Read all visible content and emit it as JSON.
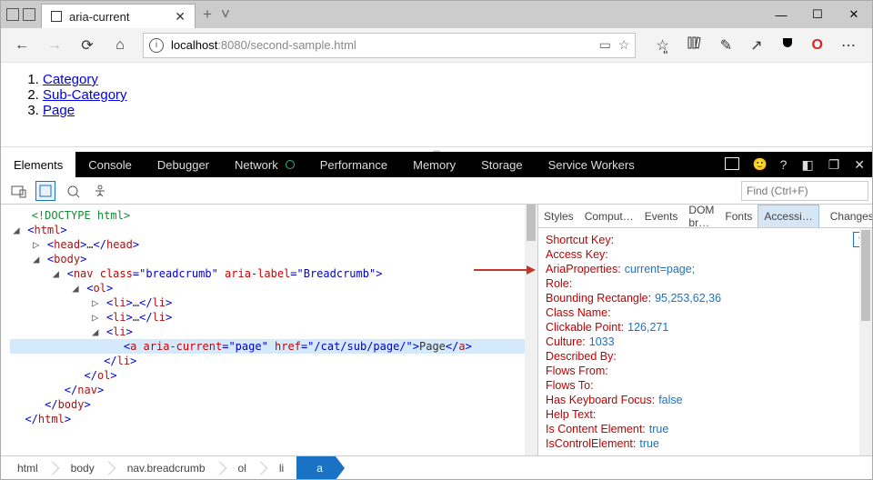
{
  "window": {
    "tab_title": "aria-current"
  },
  "url": {
    "prefix": "localhost",
    "port_path": ":8080/second-sample.html"
  },
  "page_links": {
    "l1": "Category",
    "l2": "Sub-Category",
    "l3": "Page"
  },
  "devtools": {
    "tabs": {
      "elements": "Elements",
      "console": "Console",
      "debugger": "Debugger",
      "network": "Network",
      "performance": "Performance",
      "memory": "Memory",
      "storage": "Storage",
      "service_workers": "Service Workers"
    },
    "find_placeholder": "Find (Ctrl+F)",
    "side_tabs": {
      "styles": "Styles",
      "computed": "Comput…",
      "events": "Events",
      "dom": "DOM br…",
      "fonts": "Fonts",
      "accessibility": "Accessi…",
      "changes": "Changes"
    }
  },
  "dom": {
    "doctype": "<!DOCTYPE html>",
    "nav_class": "breadcrumb",
    "nav_aria_label": "Breadcrumb",
    "a_aria_current": "page",
    "a_href": "/cat/sub/page/",
    "a_text": "Page"
  },
  "accessibility": {
    "shortcut_key": {
      "k": "Shortcut Key:",
      "v": ""
    },
    "access_key": {
      "k": "Access Key:",
      "v": ""
    },
    "aria_properties": {
      "k": "AriaProperties:",
      "v": "current=page;"
    },
    "role": {
      "k": "Role:",
      "v": ""
    },
    "bounding_rect": {
      "k": "Bounding Rectangle:",
      "v": "95,253,62,36"
    },
    "class_name": {
      "k": "Class Name:",
      "v": ""
    },
    "clickable_point": {
      "k": "Clickable Point:",
      "v": "126,271"
    },
    "culture": {
      "k": "Culture:",
      "v": "1033"
    },
    "described_by": {
      "k": "Described By:",
      "v": ""
    },
    "flows_from": {
      "k": "Flows From:",
      "v": ""
    },
    "flows_to": {
      "k": "Flows To:",
      "v": ""
    },
    "has_keyboard_focus": {
      "k": "Has Keyboard Focus:",
      "v": "false"
    },
    "help_text": {
      "k": "Help Text:",
      "v": ""
    },
    "is_content_element": {
      "k": "Is Content Element:",
      "v": "true"
    },
    "is_control_element": {
      "k": "IsControlElement:",
      "v": "true"
    }
  },
  "breadcrumbs": {
    "b1": "html",
    "b2": "body",
    "b3": "nav.breadcrumb",
    "b4": "ol",
    "b5": "li",
    "b6": "a"
  }
}
